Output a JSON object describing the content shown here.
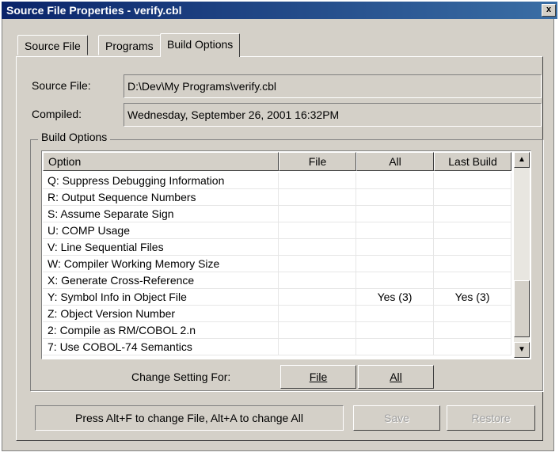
{
  "window": {
    "title": "Source File Properties - verify.cbl",
    "close_glyph": "x"
  },
  "tabs": [
    {
      "label": "Source File"
    },
    {
      "label": "Programs"
    },
    {
      "label": "Build Options",
      "active": true
    }
  ],
  "fields": {
    "source_file_label": "Source File:",
    "source_file_value": "D:\\Dev\\My Programs\\verify.cbl",
    "compiled_label": "Compiled:",
    "compiled_value": "Wednesday, September 26, 2001 16:32PM"
  },
  "build_options": {
    "group_title": "Build Options",
    "columns": [
      "Option",
      "File",
      "All",
      "Last Build"
    ],
    "rows": [
      {
        "option": "Q: Suppress Debugging Information",
        "file": "",
        "all": "",
        "last": ""
      },
      {
        "option": "R: Output Sequence Numbers",
        "file": "",
        "all": "",
        "last": ""
      },
      {
        "option": "S: Assume Separate Sign",
        "file": "",
        "all": "",
        "last": ""
      },
      {
        "option": "U: COMP Usage",
        "file": "",
        "all": "",
        "last": ""
      },
      {
        "option": "V: Line Sequential Files",
        "file": "",
        "all": "",
        "last": ""
      },
      {
        "option": "W: Compiler Working Memory Size",
        "file": "",
        "all": "",
        "last": ""
      },
      {
        "option": "X: Generate Cross-Reference",
        "file": "",
        "all": "",
        "last": ""
      },
      {
        "option": "Y: Symbol Info in Object File",
        "file": "",
        "all": "Yes (3)",
        "last": "Yes (3)"
      },
      {
        "option": "Z: Object Version Number",
        "file": "",
        "all": "",
        "last": ""
      },
      {
        "option": "2: Compile as RM/COBOL 2.n",
        "file": "",
        "all": "",
        "last": ""
      },
      {
        "option": "7: Use COBOL-74 Semantics",
        "file": "",
        "all": "",
        "last": ""
      }
    ],
    "scroll_up_glyph": "▲",
    "scroll_down_glyph": "▼"
  },
  "change_setting": {
    "label": "Change Setting For:",
    "file_button": "File",
    "all_button": "All"
  },
  "status_text": "Press Alt+F to change File, Alt+A to change All",
  "buttons": {
    "save": "Save",
    "restore": "Restore"
  }
}
